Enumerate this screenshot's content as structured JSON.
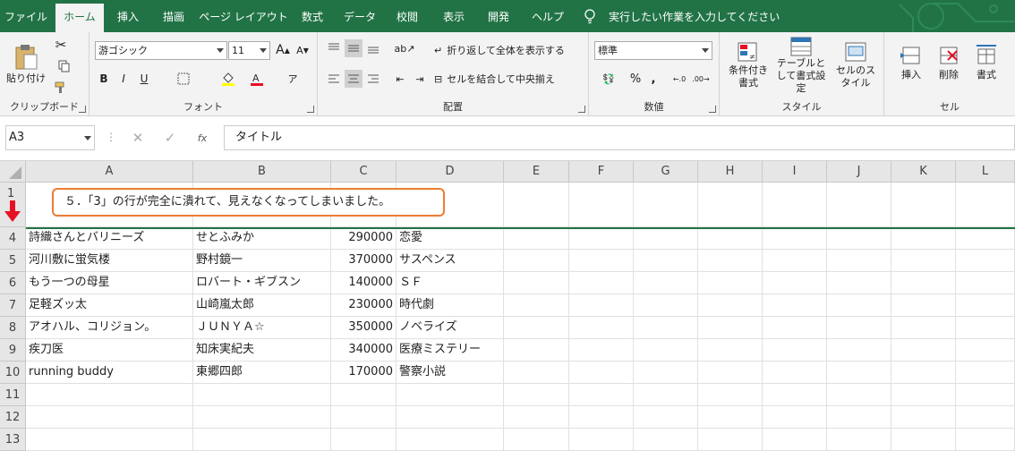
{
  "tabs": [
    "ファイル",
    "ホーム",
    "挿入",
    "描画",
    "ページ レイアウト",
    "数式",
    "データ",
    "校閲",
    "表示",
    "開発",
    "ヘルプ"
  ],
  "tell_me": "実行したい作業を入力してください",
  "ribbon": {
    "clipboard": {
      "paste": "貼り付け",
      "label": "クリップボード"
    },
    "font": {
      "name": "游ゴシック",
      "size": "11",
      "bold": "B",
      "italic": "I",
      "underline": "U",
      "grow": "A",
      "shrink": "A",
      "label": "フォント"
    },
    "align": {
      "wrap": "折り返して全体を表示する",
      "merge": "セルを結合して中央揃え",
      "label": "配置"
    },
    "number": {
      "format": "標準",
      "percent": "%",
      "comma": ",",
      "label": "数値"
    },
    "styles": {
      "cond": "条件付き書式",
      "table": "テーブルとして書式設定",
      "cell": "セルのスタイル",
      "label": "スタイル"
    },
    "cells": {
      "insert": "挿入",
      "delete": "削除",
      "format": "書式",
      "label": "セル"
    }
  },
  "formula": {
    "namebox": "A3",
    "fx": "fx",
    "content": "タイトル"
  },
  "columns": [
    "A",
    "B",
    "C",
    "D",
    "E",
    "F",
    "G",
    "H",
    "I",
    "J",
    "K",
    "L"
  ],
  "callout": "５．「3」の行が完全に潰れて、見えなくなってしまいました。",
  "rows": [
    {
      "n": "1",
      "a": "",
      "b": "",
      "c": "",
      "d": ""
    },
    {
      "n": "4",
      "a": "詩織さんとバリニーズ",
      "b": "せとふみか",
      "c": "290000",
      "d": "恋愛"
    },
    {
      "n": "5",
      "a": "河川敷に蛍気楼",
      "b": "野村鏡一",
      "c": "370000",
      "d": "サスペンス"
    },
    {
      "n": "6",
      "a": "もう一つの母星",
      "b": "ロバート・ギブスン",
      "c": "140000",
      "d": "ＳＦ"
    },
    {
      "n": "7",
      "a": "足軽ズッ太",
      "b": "山崎嵐太郎",
      "c": "230000",
      "d": "時代劇"
    },
    {
      "n": "8",
      "a": "アオハル、コリジョン。",
      "b": "ＪＵＮＹＡ☆",
      "c": "350000",
      "d": "ノベライズ"
    },
    {
      "n": "9",
      "a": "疾刀医",
      "b": "知床実紀夫",
      "c": "340000",
      "d": "医療ミステリー"
    },
    {
      "n": "10",
      "a": "running buddy",
      "b": "東郷四郎",
      "c": "170000",
      "d": "警察小説"
    },
    {
      "n": "11",
      "a": "",
      "b": "",
      "c": "",
      "d": ""
    },
    {
      "n": "12",
      "a": "",
      "b": "",
      "c": "",
      "d": ""
    },
    {
      "n": "13",
      "a": "",
      "b": "",
      "c": "",
      "d": ""
    }
  ],
  "colors": {
    "excel_green": "#217346",
    "callout_border": "#ed7d31",
    "arrow": "#e81123"
  }
}
